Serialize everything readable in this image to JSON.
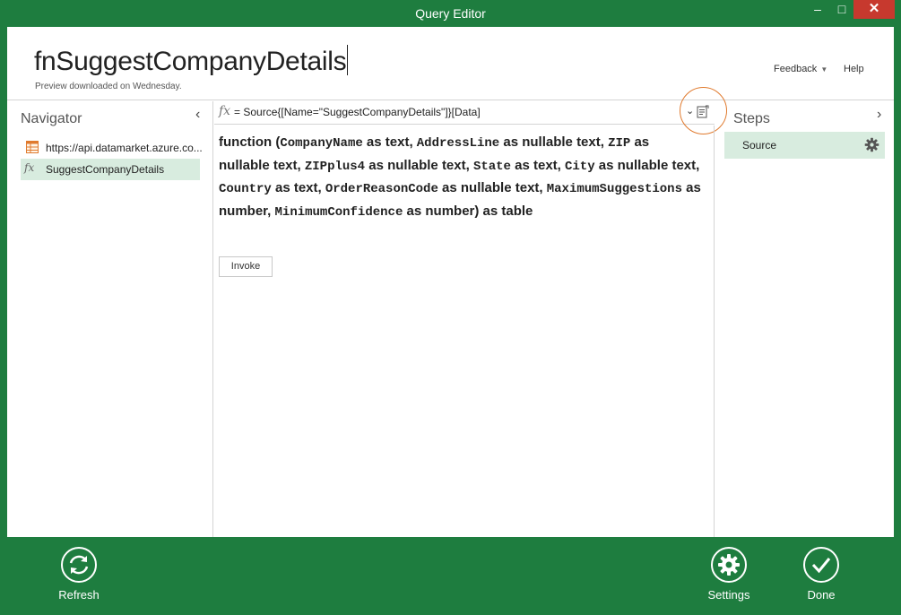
{
  "window": {
    "title": "Query Editor",
    "minimize_glyph": "–",
    "maximize_glyph": "□",
    "close_glyph": "✕"
  },
  "header": {
    "query_name": "fnSuggestCompanyDetails",
    "preview_note": "Preview downloaded on Wednesday.",
    "feedback_label": "Feedback",
    "help_label": "Help"
  },
  "navigator": {
    "title": "Navigator",
    "collapse_glyph": "‹",
    "items": [
      {
        "label": "https://api.datamarket.azure.co...",
        "icon": "table-icon"
      },
      {
        "label": "SuggestCompanyDetails",
        "icon": "fx-icon",
        "selected": true
      }
    ]
  },
  "formula_bar": {
    "fx": "fx",
    "formula": "= Source{[Name=\"SuggestCompanyDetails\"]}[Data]",
    "expand_glyph": "⌄"
  },
  "preview": {
    "function_parts": [
      {
        "t": "function (",
        "k": "kw"
      },
      {
        "t": "CompanyName",
        "k": "param"
      },
      {
        "t": " as text, ",
        "k": "kw"
      },
      {
        "t": "AddressLine",
        "k": "param"
      },
      {
        "t": " as nullable text, ",
        "k": "kw"
      },
      {
        "t": "ZIP",
        "k": "param"
      },
      {
        "t": " as nullable text, ",
        "k": "kw"
      },
      {
        "t": "ZIPplus4",
        "k": "param"
      },
      {
        "t": " as nullable text, ",
        "k": "kw"
      },
      {
        "t": "State",
        "k": "param"
      },
      {
        "t": " as text, ",
        "k": "kw"
      },
      {
        "t": "City",
        "k": "param"
      },
      {
        "t": " as nullable text, ",
        "k": "kw"
      },
      {
        "t": "Country",
        "k": "param"
      },
      {
        "t": " as text, ",
        "k": "kw"
      },
      {
        "t": "OrderReasonCode",
        "k": "param"
      },
      {
        "t": " as nullable text, ",
        "k": "kw"
      },
      {
        "t": "MaximumSuggestions",
        "k": "param"
      },
      {
        "t": " as number, ",
        "k": "kw"
      },
      {
        "t": "MinimumConfidence",
        "k": "param"
      },
      {
        "t": " as number) as table",
        "k": "kw"
      }
    ],
    "invoke_label": "Invoke"
  },
  "steps": {
    "title": "Steps",
    "expand_glyph": "›",
    "items": [
      {
        "label": "Source"
      }
    ]
  },
  "footer": {
    "refresh_label": "Refresh",
    "settings_label": "Settings",
    "done_label": "Done"
  },
  "colors": {
    "accent_green": "#1e7d3f",
    "selection_green": "#d8ecdf",
    "highlight_orange": "#e07a2e",
    "close_red": "#c7392e"
  }
}
